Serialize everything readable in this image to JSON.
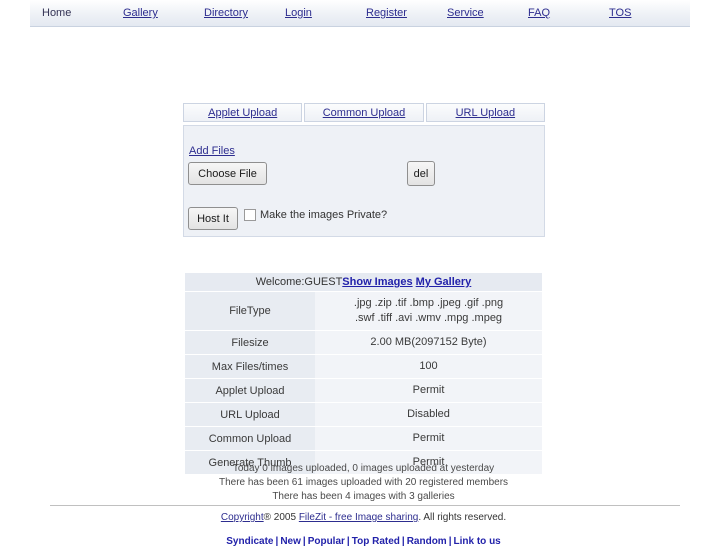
{
  "nav": {
    "items": [
      {
        "label": "Home",
        "is_link": false
      },
      {
        "label": "Gallery",
        "is_link": true
      },
      {
        "label": "Directory",
        "is_link": true
      },
      {
        "label": "Login",
        "is_link": true
      },
      {
        "label": "Register",
        "is_link": true
      },
      {
        "label": "Service",
        "is_link": true
      },
      {
        "label": "FAQ",
        "is_link": true
      },
      {
        "label": "TOS",
        "is_link": true
      }
    ]
  },
  "upload": {
    "tabs": [
      {
        "label": "Applet Upload"
      },
      {
        "label": "Common Upload"
      },
      {
        "label": "URL Upload"
      }
    ],
    "add_files_label": "Add Files",
    "choose_file_label": "Choose File",
    "del_label": "del",
    "host_it_label": "Host It",
    "private_label": "Make the images Private?"
  },
  "welcome": {
    "text": "Welcome:GUEST",
    "show_images_label": "Show Images",
    "my_gallery_label": "My Gallery"
  },
  "info": {
    "rows": [
      {
        "label": "FileType",
        "value": ".jpg .zip .tif .bmp .jpeg .gif .png\n.swf .tiff .avi .wmv .mpg .mpeg"
      },
      {
        "label": "Filesize",
        "value": "2.00 MB(2097152 Byte)"
      },
      {
        "label": "Max Files/times",
        "value": "100"
      },
      {
        "label": "Applet Upload",
        "value": "Permit"
      },
      {
        "label": "URL Upload",
        "value": "Disabled"
      },
      {
        "label": "Common Upload",
        "value": "Permit"
      },
      {
        "label": "Generate Thumb",
        "value": "Permit"
      }
    ]
  },
  "stats": {
    "line1": "Today 0 images uploaded, 0 images uploaded at yesterday",
    "line2": "There has been 61 images uploaded with 20 registered members",
    "line3": "There has been 4 images with 3 galleries"
  },
  "footer": {
    "copyright_link": "Copyright",
    "copyright_mid": "® 2005 ",
    "site_link": "FileZit - free Image sharing",
    "copyright_end": ". All rights reserved.",
    "links": [
      "Syndicate",
      "New",
      "Popular",
      "Top Rated",
      "Random",
      "Link to us"
    ],
    "separator": "|"
  },
  "colors": {
    "link": "#2d2d8f",
    "nav_bg": "#eef1f6",
    "panel_bg": "#eef1f6",
    "table_label_bg": "#e8ecf2",
    "table_value_bg": "#f2f4f8"
  }
}
